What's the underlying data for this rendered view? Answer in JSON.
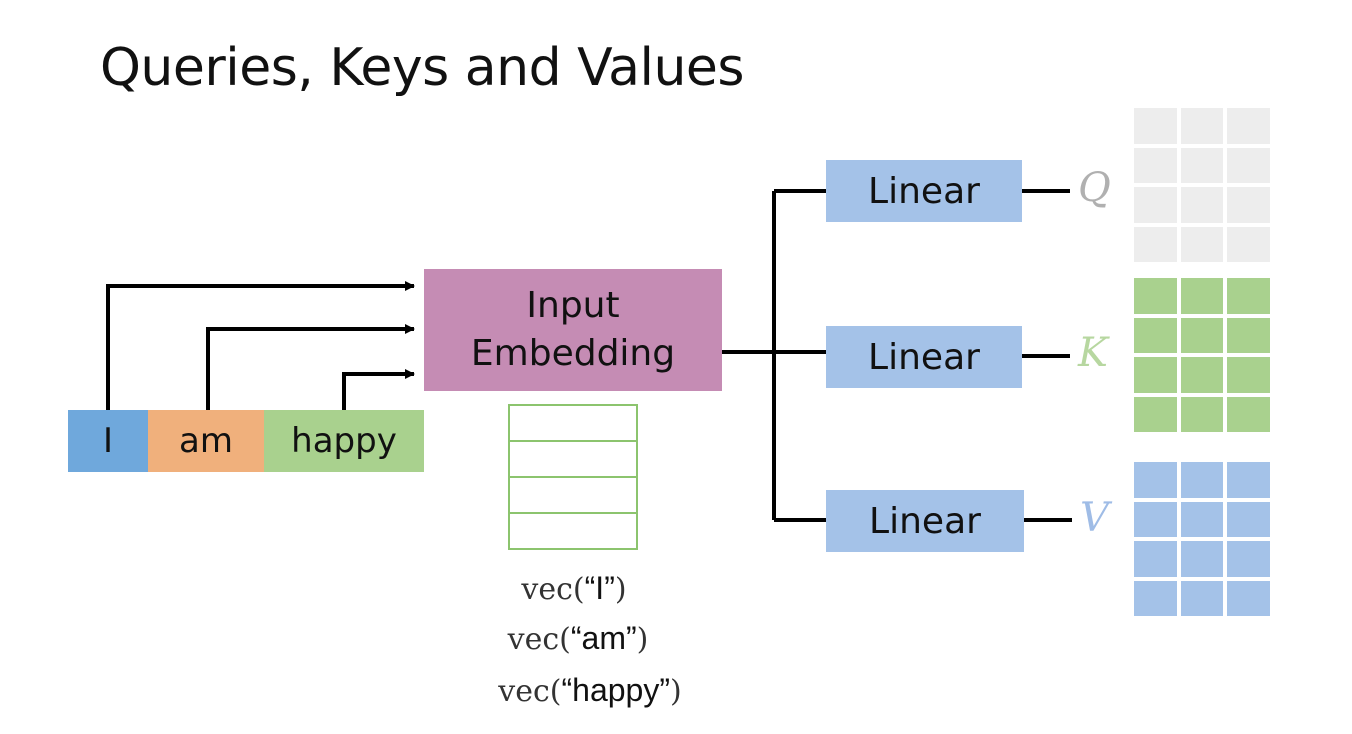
{
  "title": "Queries, Keys and Values",
  "tokens": [
    "I",
    "am",
    "happy"
  ],
  "embedding": {
    "line1": "Input",
    "line2": "Embedding"
  },
  "linear_label": "Linear",
  "outputs": {
    "q": "Q",
    "k": "K",
    "v": "V"
  },
  "vectors": [
    {
      "fn": "vec(",
      "arg": "“I”",
      "close": ")"
    },
    {
      "fn": "vec(",
      "arg": "“am”",
      "close": ")"
    },
    {
      "fn": "vec(",
      "arg": "“happy”",
      "close": ")"
    }
  ],
  "colors": {
    "token_I": "#6fa8dc",
    "token_am": "#f0b07c",
    "token_happy": "#a9d18e",
    "embedding": "#c58cb4",
    "linear": "#a4c2e8",
    "query": "#ededed",
    "key": "#a9d18e",
    "value": "#a4c2e8"
  }
}
